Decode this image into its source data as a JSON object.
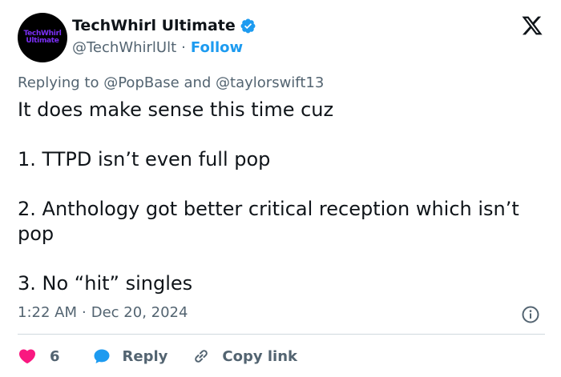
{
  "author": {
    "avatar_text_line1": "TechWhirl",
    "avatar_text_line2": "Ultimate",
    "display_name": "TechWhirl Ultimate",
    "handle": "@TechWhirlUlt",
    "separator": "·",
    "follow_label": "Follow",
    "verified": true
  },
  "reply_context": {
    "prefix": "Replying to",
    "mention1": "@PopBase",
    "conjunction": "and",
    "mention2": "@taylorswift13"
  },
  "tweet": {
    "line1": "It does make sense this time cuz",
    "line2": "1. TTPD isn’t even full pop",
    "line3": "2. Anthology got better critical reception which isn’t pop",
    "line4": "3. No “hit” singles"
  },
  "meta": {
    "time": "1:22 AM",
    "separator": "·",
    "date": "Dec 20, 2024"
  },
  "actions": {
    "like_count": "6",
    "reply_label": "Reply",
    "copy_link_label": "Copy link"
  },
  "colors": {
    "accent": "#1d9bf0",
    "like": "#f91880",
    "muted_text": "#536471",
    "primary_text": "#0f1419",
    "avatar_text": "#7b2ff7"
  },
  "icons": {
    "verified": "verified-badge-icon",
    "platform": "x-logo-icon",
    "info": "info-icon",
    "like": "heart-icon",
    "reply": "reply-bubble-icon",
    "copy": "link-icon"
  }
}
